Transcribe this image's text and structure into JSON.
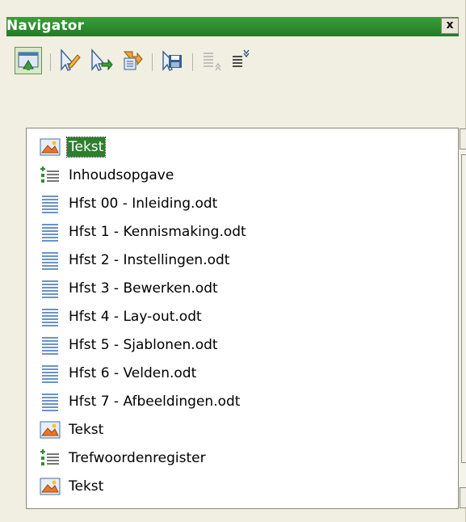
{
  "window": {
    "title": "Navigator",
    "close_label": "x"
  },
  "toolbar": {
    "buttons": [
      {
        "name": "navigator-toggle-icon",
        "active": true
      },
      {
        "name": "edit-icon"
      },
      {
        "name": "edit-link-icon"
      },
      {
        "name": "insert-icon"
      },
      {
        "name": "save-as-icon"
      },
      {
        "name": "promote-chapter-icon"
      },
      {
        "name": "demote-chapter-icon"
      }
    ]
  },
  "list": {
    "items": [
      {
        "label": "Tekst",
        "icon": "section-icon",
        "selected": true
      },
      {
        "label": "Inhoudsopgave",
        "icon": "index-icon"
      },
      {
        "label": "Hfst 00 - Inleiding.odt",
        "icon": "document-icon"
      },
      {
        "label": "Hfst 1 - Kennismaking.odt",
        "icon": "document-icon"
      },
      {
        "label": "Hfst 2 - Instellingen.odt",
        "icon": "document-icon"
      },
      {
        "label": "Hfst 3 - Bewerken.odt",
        "icon": "document-icon"
      },
      {
        "label": "Hfst 4 - Lay-out.odt",
        "icon": "document-icon"
      },
      {
        "label": "Hfst 5 - Sjablonen.odt",
        "icon": "document-icon"
      },
      {
        "label": "Hfst 6 - Velden.odt",
        "icon": "document-icon"
      },
      {
        "label": "Hfst 7 - Afbeeldingen.odt",
        "icon": "document-icon"
      },
      {
        "label": "Tekst",
        "icon": "section-icon"
      },
      {
        "label": "Trefwoordenregister",
        "icon": "index-icon"
      },
      {
        "label": "Tekst",
        "icon": "section-icon"
      }
    ]
  },
  "colors": {
    "titlebar": "#2e8b2e",
    "selection": "#2d7f2d"
  }
}
